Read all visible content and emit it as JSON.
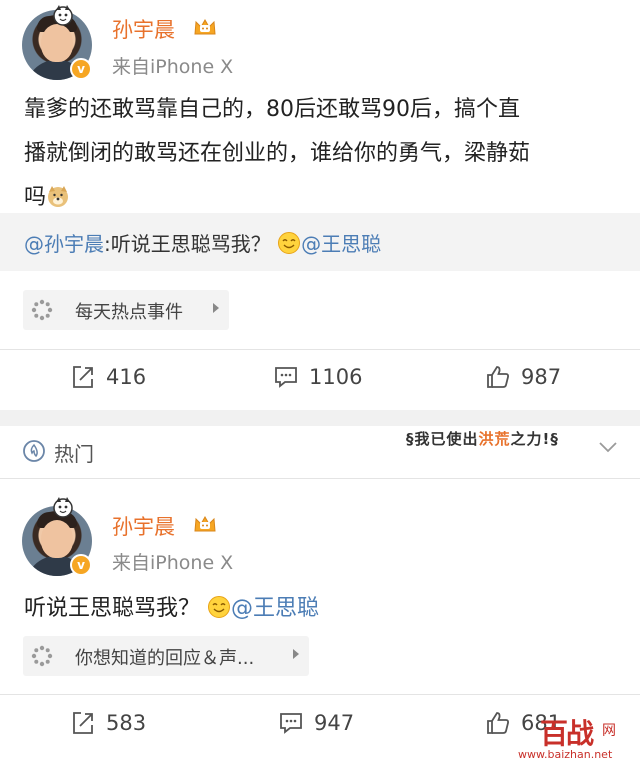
{
  "post1": {
    "username": "孙宇晨",
    "source": "来自iPhone X",
    "content_line1": "靠爹的还敢骂靠自己的，80后还敢骂90后，搞个直",
    "content_line2": "播就倒闭的敢骂还在创业的，谁给你的勇气，梁静茹",
    "content_line3": "吗",
    "repost_author": "@孙宇晨",
    "repost_text": ":听说王思聪骂我？",
    "repost_mention": "@王思聪",
    "topic_label": "每天热点事件",
    "repost_count": "416",
    "comment_count": "1106",
    "like_count": "987"
  },
  "hot_section": {
    "label": "热门",
    "sticker_text_a": "我已使出",
    "sticker_text_hl": "洪荒",
    "sticker_text_b": "之力!"
  },
  "post2": {
    "username": "孙宇晨",
    "source": "来自iPhone X",
    "content": "听说王思聪骂我？",
    "mention": "@王思聪",
    "topic_label": "你想知道的回应＆声...",
    "repost_count": "583",
    "comment_count": "947",
    "like_count": "681"
  },
  "watermark": {
    "logo": "百战",
    "net": "网",
    "url": "www.baizhan.net"
  },
  "colors": {
    "username": "#e8722c",
    "link": "#4c7db5",
    "verified_badge": "#f6a623",
    "watermark": "#c8302a"
  },
  "icons": {
    "repost": "share-icon",
    "comment": "comment-icon",
    "like": "thumbs-up-icon",
    "hot": "hot-topic-icon",
    "topic": "loading-spinner-icon"
  }
}
